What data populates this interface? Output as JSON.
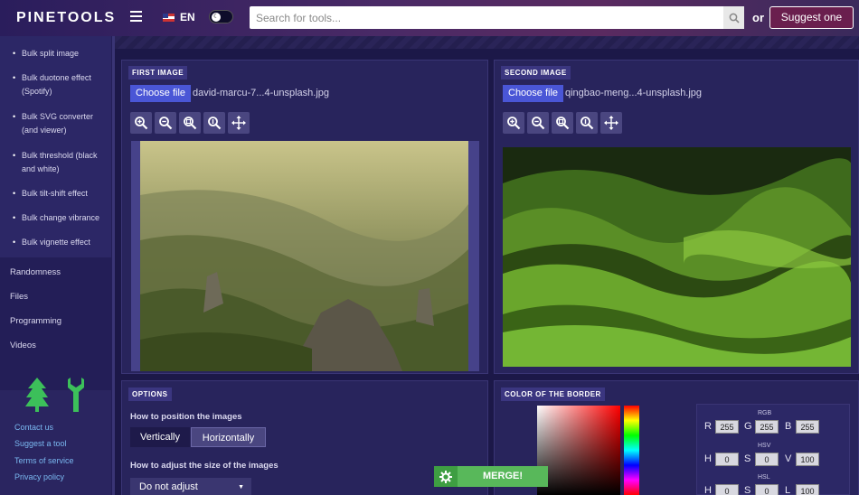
{
  "header": {
    "logo": "PINETOOLS",
    "lang": "EN",
    "search_placeholder": "Search for tools...",
    "or_text": "or",
    "suggest_label": "Suggest one"
  },
  "sidebar": {
    "sub_items": [
      "Bulk split image",
      "Bulk duotone effect (Spotify)",
      "Bulk SVG converter (and viewer)",
      "Bulk threshold (black and white)",
      "Bulk tilt-shift effect",
      "Bulk change vibrance",
      "Bulk vignette effect"
    ],
    "categories": [
      "Randomness",
      "Files",
      "Programming",
      "Videos"
    ],
    "footer_links": [
      "Contact us",
      "Suggest a tool",
      "Terms of service",
      "Privacy policy"
    ]
  },
  "first_image": {
    "tag": "FIRST IMAGE",
    "choose_label": "Choose file",
    "filename": "david-marcu-7...4-unsplash.jpg"
  },
  "second_image": {
    "tag": "SECOND IMAGE",
    "choose_label": "Choose file",
    "filename": "qingbao-meng...4-unsplash.jpg"
  },
  "tools": [
    "zoom-in-icon",
    "zoom-out-icon",
    "zoom-fit-icon",
    "zoom-reset-icon",
    "move-icon"
  ],
  "options": {
    "tag": "OPTIONS",
    "position_label": "How to position the images",
    "position_options": [
      "Vertically",
      "Horizontally"
    ],
    "position_selected": "Horizontally",
    "size_label": "How to adjust the size of the images",
    "size_value": "Do not adjust"
  },
  "border_color": {
    "tag": "COLOR OF THE BORDER",
    "rgb_label": "RGB",
    "hsv_label": "HSV",
    "hsl_label": "HSL",
    "r": "255",
    "g": "255",
    "b": "255",
    "h": "0",
    "s": "0",
    "v": "100",
    "hl_h": "0",
    "hl_s": "0",
    "hl_l": "100",
    "letters": {
      "r": "R",
      "g": "G",
      "b": "B",
      "h": "H",
      "s": "S",
      "v": "V",
      "l": "L"
    }
  },
  "merge_label": "MERGE!",
  "colors": {
    "choose_button": "#4a56d6",
    "merge_button": "#58b85a",
    "footer_link": "#7ab8f0",
    "tree_icon": "#3cc05a"
  }
}
